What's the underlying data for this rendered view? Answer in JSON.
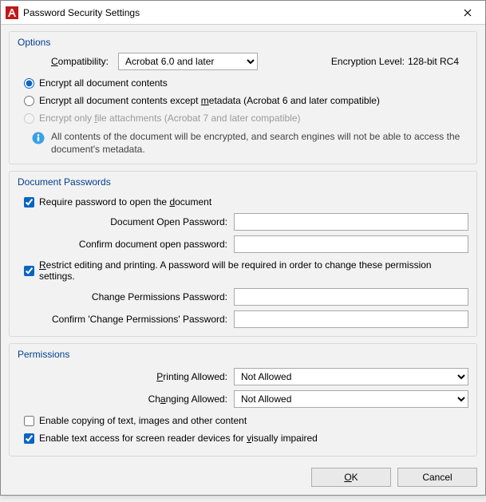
{
  "window": {
    "title": "Password Security Settings",
    "close_name": "close-icon"
  },
  "options": {
    "group_title": "Options",
    "compatibility_label_pre": "C",
    "compatibility_label_post": "ompatibility:",
    "compatibility_value": "Acrobat 6.0 and later",
    "encryption_label": "Encryption Level:",
    "encryption_value": "128-bit RC4",
    "radio_all": "Encrypt all document contents",
    "radio_except_pre": "Encrypt all document contents except ",
    "radio_except_u": "m",
    "radio_except_mid": "etadata (Acrobat 6 and later compatible)",
    "radio_attachments_pre": "Encrypt only ",
    "radio_attachments_u": "f",
    "radio_attachments_post": "ile attachments (Acrobat 7 and later compatible)",
    "info_text": "All contents of the document will be encrypted, and search engines will not be able to access the document's metadata."
  },
  "passwords": {
    "group_title": "Document Passwords",
    "require_open_pre": "Require password to open the ",
    "require_open_u": "d",
    "require_open_post": "ocument",
    "open_pw_label": "Document Open Password:",
    "confirm_open_label": "Confirm document open password:",
    "restrict_pre": "",
    "restrict_u": "R",
    "restrict_post": "estrict editing and printing. A password will be required in order to change these permission settings.",
    "change_pw_label": "Change Permissions Password:",
    "confirm_change_label": "Confirm 'Change Permissions' Password:"
  },
  "permissions": {
    "group_title": "Permissions",
    "printing_label_pre": "",
    "printing_label_u": "P",
    "printing_label_post": "rinting Allowed:",
    "printing_value": "Not Allowed",
    "changing_label_pre": "Ch",
    "changing_label_u": "a",
    "changing_label_post": "nging Allowed:",
    "changing_value": "Not Allowed",
    "copy_label": "Enable copying of text, images and other content",
    "screenreader_pre": "Enable text access for screen reader devices for ",
    "screenreader_u": "v",
    "screenreader_post": "isually impaired"
  },
  "buttons": {
    "ok_u": "O",
    "ok_post": "K",
    "cancel": "Cancel"
  }
}
